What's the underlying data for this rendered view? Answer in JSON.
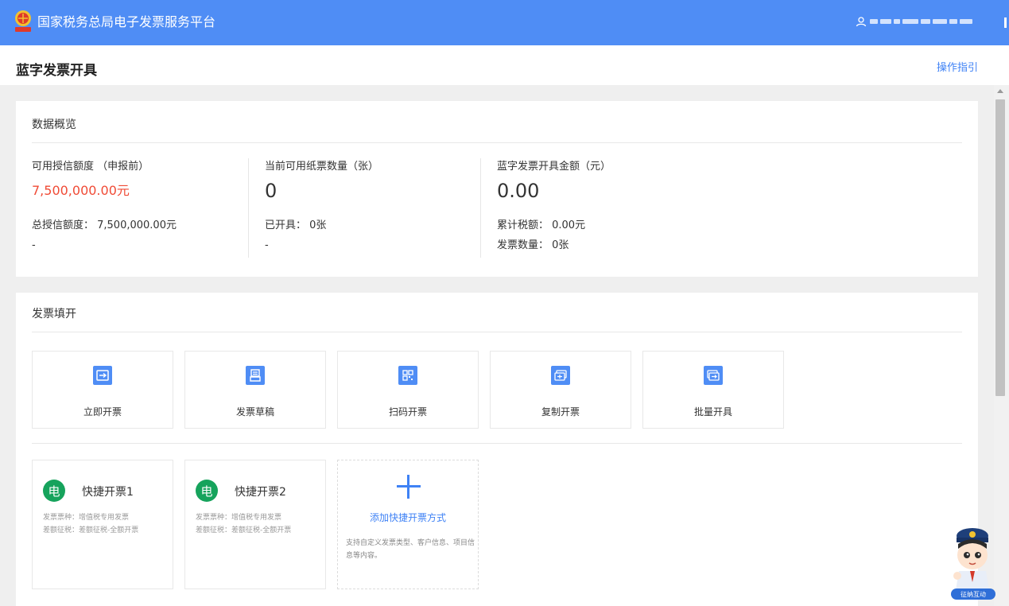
{
  "header": {
    "app_title": "国家税务总局电子发票服务平台",
    "logo_icon": "tax-emblem-icon",
    "user_icon": "user-icon",
    "brand_color": "#4f8df5"
  },
  "page": {
    "title": "蓝字发票开具",
    "guide_link": "操作指引"
  },
  "overview": {
    "title": "数据概览",
    "credit": {
      "label": "可用授信额度 （申报前）",
      "value": "7,500,000.00元",
      "total": "总授信额度： 7,500,000.00元",
      "note": "-"
    },
    "paper": {
      "label": "当前可用纸票数量（张）",
      "value": "0",
      "issued": "已开具： 0张",
      "note": "-"
    },
    "blue_amount": {
      "label": "蓝字发票开具金额（元）",
      "value": "0.00",
      "tax": "累计税额： 0.00元",
      "count": "发票数量： 0张"
    }
  },
  "fill": {
    "title": "发票填开",
    "functions": [
      {
        "label": "立即开票",
        "icon": "issue-now-icon"
      },
      {
        "label": "发票草稿",
        "icon": "draft-icon"
      },
      {
        "label": "扫码开票",
        "icon": "qrcode-icon"
      },
      {
        "label": "复制开票",
        "icon": "copy-invoice-icon"
      },
      {
        "label": "批量开具",
        "icon": "batch-issue-icon"
      }
    ],
    "quick": [
      {
        "badge": "电",
        "name": "快捷开票1",
        "line1": "发票票种：增值税专用发票",
        "line2": "差额征税：差额征税-全额开票"
      },
      {
        "badge": "电",
        "name": "快捷开票2",
        "line1": "发票票种：增值税专用发票",
        "line2": "差额征税：差额征税-全额开票"
      }
    ],
    "add_quick": {
      "label": "添加快捷开票方式",
      "desc": "支持自定义发票类型、客户信息、项目信息等内容。"
    }
  },
  "mascot": {
    "badge": "征纳互动",
    "icon": "tax-officer-mascot-icon"
  },
  "colors": {
    "accent": "#3f82f5",
    "credit_value": "#f04b36",
    "quick_badge": "#16a35c"
  }
}
